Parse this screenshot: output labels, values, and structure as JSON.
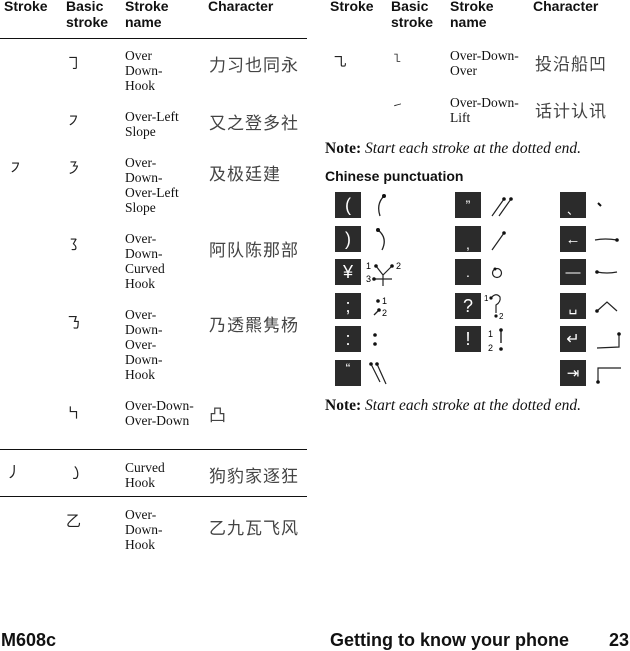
{
  "left_table": {
    "headers": [
      "Stroke",
      "Basic stroke",
      "Stroke name",
      "Character"
    ],
    "rows": [
      {
        "stroke": "",
        "basic": "㇆",
        "name": "Over Down-Hook",
        "chars": "力习也同永"
      },
      {
        "stroke": "",
        "basic": "㇇",
        "name": "Over-Left Slope",
        "chars": "又之登多社"
      },
      {
        "stroke": "㇇",
        "basic": "㇋",
        "name": "Over-Down-Over-Left Slope",
        "chars": "及极廷建"
      },
      {
        "stroke": "",
        "basic": "㇌",
        "name": "Over-Down-Curved Hook",
        "chars": "阿队陈那部"
      },
      {
        "stroke": "",
        "basic": "㇡",
        "name": "Over-Down-Over-Down-Hook",
        "chars": "乃透羆隽杨"
      },
      {
        "stroke": "",
        "basic": "㇞",
        "name": "Over-Down-Over-Down",
        "chars": "凸"
      },
      {
        "stroke": "丿",
        "basic": "㇁",
        "name": "Curved Hook",
        "chars": "狗豹家逐狂"
      },
      {
        "stroke": "",
        "basic": "乙",
        "name": "Over-Down-Hook",
        "chars": "乙九瓦飞风"
      }
    ]
  },
  "right_table": {
    "headers": [
      "Stroke",
      "Basic stroke",
      "Stroke name",
      "Character"
    ],
    "rows": [
      {
        "stroke": "㇈",
        "basic": "㇅",
        "name": "Over-Down-Over",
        "chars": "投沿船凹"
      },
      {
        "stroke": "",
        "basic": "㇀",
        "name": "Over-Down-Lift",
        "chars": "话计认讯"
      }
    ]
  },
  "note1": {
    "label": "Note:",
    "text": "Start each stroke at the dotted end."
  },
  "punctuation": {
    "title": "Chinese punctuation",
    "keys": [
      {
        "key": "(",
        "name": "open-paren"
      },
      {
        "key": ")",
        "name": "close-paren"
      },
      {
        "key": "¥",
        "name": "yen",
        "hint_labels": [
          "1",
          "2",
          "3"
        ]
      },
      {
        "key": ";",
        "name": "semicolon",
        "hint_labels": [
          "1",
          "2"
        ]
      },
      {
        "key": ":",
        "name": "colon"
      },
      {
        "key": "“",
        "name": "open-quote"
      },
      {
        "key": "”",
        "name": "close-quote"
      },
      {
        "key": ",",
        "name": "comma"
      },
      {
        "key": ".",
        "name": "period"
      },
      {
        "key": "?",
        "name": "question",
        "hint_labels": [
          "1",
          "2"
        ]
      },
      {
        "key": "!",
        "name": "exclamation",
        "hint_labels": [
          "1",
          "2"
        ]
      },
      {
        "key": "、",
        "name": "enumeration-comma"
      },
      {
        "key": "←",
        "name": "backspace"
      },
      {
        "key": "—",
        "name": "dash"
      },
      {
        "key": "␣",
        "name": "space"
      },
      {
        "key": "↵",
        "name": "enter"
      },
      {
        "key": "⇥",
        "name": "tab"
      }
    ]
  },
  "note2": {
    "label": "Note:",
    "text": "Start each stroke at the dotted end."
  },
  "footer": {
    "model": "M608c",
    "section": "Getting to know your phone",
    "page": "23"
  }
}
